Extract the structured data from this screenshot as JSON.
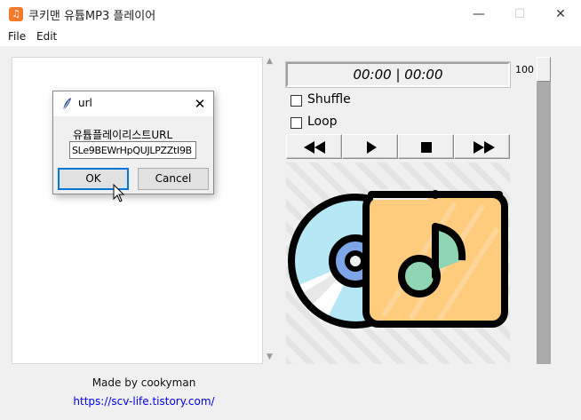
{
  "window": {
    "title": "쿠키맨 유튭MP3 플레이어",
    "app_icon": "music-note-icon",
    "minimize_glyph": "—",
    "maximize_glyph": "☐",
    "close_glyph": "✕"
  },
  "menubar": {
    "items": [
      "File",
      "Edit"
    ]
  },
  "dialog": {
    "title": "url",
    "title_icon": "feather-icon",
    "close_glyph": "✕",
    "prompt": "유튭플레이리스트URL",
    "input_value": "SLe9BEWrHpQUJLPZZtI9B",
    "ok_label": "OK",
    "cancel_label": "Cancel"
  },
  "footer": {
    "made_by": "Made by cookyman",
    "link": "https://scv-life.tistory.com/"
  },
  "player": {
    "time": "00:00 | 00:00",
    "shuffle_label": "Shuffle",
    "shuffle_checked": false,
    "loop_label": "Loop",
    "loop_checked": false,
    "controls": [
      "rewind-icon",
      "play-icon",
      "stop-icon",
      "fast-forward-icon"
    ],
    "volume": 100,
    "volume_label": "100",
    "artwork": "cd-album-music-icon"
  },
  "colors": {
    "album": "#ffcb7c",
    "disc": "#b5e7f5",
    "disc_hub": "#7da5e8",
    "note": "#8fd5b4",
    "app_icon": "#f47a2a",
    "link": "#0000ee",
    "focus": "#0078d7"
  }
}
